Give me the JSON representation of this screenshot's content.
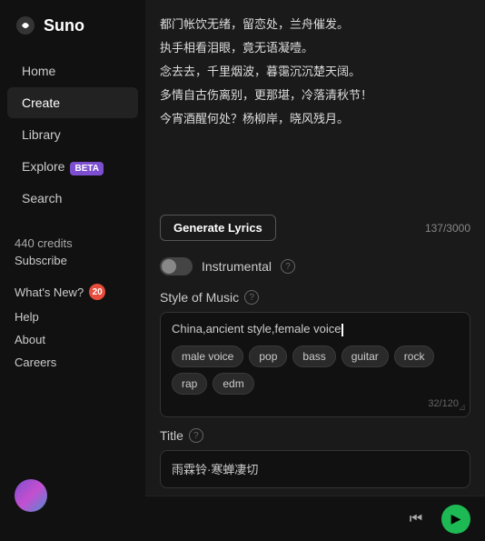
{
  "app": {
    "name": "Suno"
  },
  "sidebar": {
    "nav_items": [
      {
        "id": "home",
        "label": "Home",
        "active": false
      },
      {
        "id": "create",
        "label": "Create",
        "active": true
      },
      {
        "id": "library",
        "label": "Library",
        "active": false
      },
      {
        "id": "explore",
        "label": "Explore",
        "active": false,
        "badge": "BETA"
      },
      {
        "id": "search",
        "label": "Search",
        "active": false
      }
    ],
    "credits": "440 credits",
    "subscribe": "Subscribe",
    "whats_new": "What's New?",
    "whats_new_badge": "20",
    "help": "Help",
    "about": "About",
    "careers": "Careers"
  },
  "lyrics": {
    "lines": [
      "都门帐饮无绪，留恋处，兰舟催发。",
      "执手相看泪眼，竟无语凝噎。",
      "念去去，千里烟波，暮霭沉沉楚天阔。",
      "多情自古伤离别，更那堪，冷落清秋节！",
      "今宵酒醒何处？杨柳岸，晓风残月。"
    ],
    "generate_button": "Generate Lyrics",
    "char_count": "137/3000"
  },
  "instrumental": {
    "label": "Instrumental",
    "enabled": false
  },
  "style_of_music": {
    "label": "Style of Music",
    "value": "China,ancient style,female voice",
    "tags": [
      "male voice",
      "pop",
      "bass",
      "guitar",
      "rock",
      "rap",
      "edm"
    ],
    "char_count": "32/120"
  },
  "title": {
    "label": "Title",
    "value": "雨霖铃·寒蝉凄切"
  },
  "player": {
    "skip_back_icon": "⏮",
    "play_icon": "▶"
  }
}
